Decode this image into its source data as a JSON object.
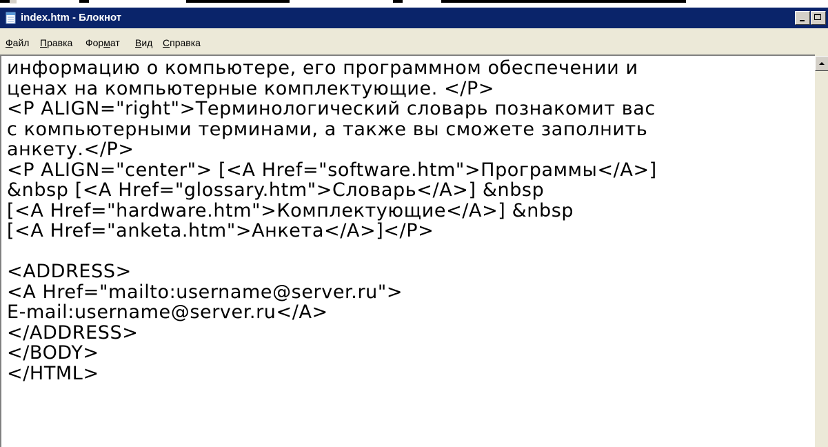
{
  "window": {
    "title": "index.htm - Блокнот"
  },
  "menu": {
    "items": [
      {
        "label": "Файл",
        "accel": "Ф",
        "rest": "айл"
      },
      {
        "label": "Правка",
        "accel": "П",
        "rest": "равка"
      },
      {
        "label": "Формат",
        "pre": "Фор",
        "accel": "м",
        "rest": "ат"
      },
      {
        "label": "Вид",
        "accel": "В",
        "rest": "ид"
      },
      {
        "label": "Справка",
        "accel": "С",
        "rest": "правка"
      }
    ]
  },
  "editor": {
    "lines": [
      "информацию о компьютере, его программном обеспечении и",
      "ценах на компьютерные комплектующие. </P>",
      "<P ALIGN=\"right\">Терминологический словарь познакомит вас",
      "с компьютерными терминами, а также вы сможете заполнить",
      "анкету.</P>",
      "<P ALIGN=\"center\"> [<A Href=\"software.htm\">Программы</A>]",
      "&nbsp [<A Href=\"glossary.htm\">Словарь</A>] &nbsp",
      "[<A Href=\"hardware.htm\">Комплектующие</A>] &nbsp",
      "[<A Href=\"anketa.htm\">Анкета</A>]</P>",
      "",
      "<ADDRESS>",
      "<A Href=\"mailto:username@server.ru\">",
      "E-mail:username@server.ru</A>",
      "</ADDRESS>",
      "</BODY>",
      "</HTML>"
    ]
  },
  "icons": {
    "app": "notepad-icon",
    "minimize": "minimize-icon",
    "maximize": "maximize-icon",
    "scroll_up": "scroll-up-arrow-icon"
  },
  "colors": {
    "titlebar": "#0a246a",
    "chrome": "#ece9d8",
    "editor_bg": "#ffffff"
  }
}
